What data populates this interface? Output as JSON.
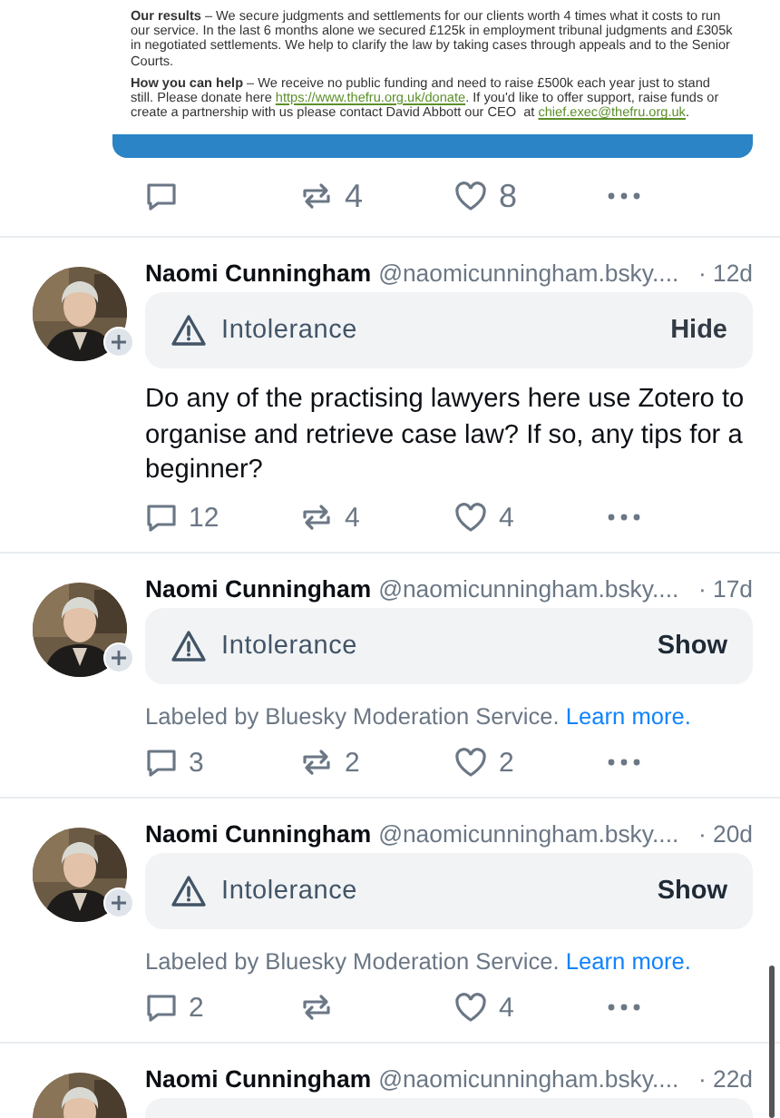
{
  "top_post": {
    "document": {
      "paragraphs": [
        [
          {
            "kind": "bold",
            "text": "Our results"
          },
          {
            "kind": "text",
            "text": " – We secure judgments and settlements for our clients worth 4 times what it costs to run our service. In the last 6 months alone we secured £125k in employment tribunal judgments and £305k in negotiated settlements. We help to clarify the law by taking cases through appeals and to the Senior Courts."
          }
        ],
        [
          {
            "kind": "bold",
            "text": "How you can help"
          },
          {
            "kind": "text",
            "text": " – We receive no public funding and need to raise £500k each year just to stand still. Please donate here "
          },
          {
            "kind": "link",
            "text": "https://www.thefru.org.uk/donate"
          },
          {
            "kind": "text",
            "text": ". If you'd like to offer support, raise funds or create a partnership with us please contact David Abbott our CEO  at "
          },
          {
            "kind": "link",
            "text": "chief.exec@thefru.org.uk"
          },
          {
            "kind": "text",
            "text": "."
          }
        ]
      ]
    },
    "actions": {
      "reposts": "4",
      "likes": "8"
    }
  },
  "posts": [
    {
      "author": "Naomi Cunningham",
      "handle": "@naomicunningham.bsky....",
      "time": "· 12d",
      "label": {
        "text": "Intolerance",
        "action": "Hide",
        "expanded": true
      },
      "body": "Do any of the practising lawyers here use Zotero to organise and retrieve case law? If so, any tips for a beginner?",
      "actions": {
        "replies": "12",
        "reposts": "4",
        "likes": "4"
      }
    },
    {
      "author": "Naomi Cunningham",
      "handle": "@naomicunningham.bsky....",
      "time": "· 17d",
      "label": {
        "text": "Intolerance",
        "action": "Show",
        "expanded": false
      },
      "note": {
        "text": "Labeled by Bluesky Moderation Service.",
        "link": "Learn more."
      },
      "actions": {
        "replies": "3",
        "reposts": "2",
        "likes": "2"
      }
    },
    {
      "author": "Naomi Cunningham",
      "handle": "@naomicunningham.bsky....",
      "time": "· 20d",
      "label": {
        "text": "Intolerance",
        "action": "Show",
        "expanded": false
      },
      "note": {
        "text": "Labeled by Bluesky Moderation Service.",
        "link": "Learn more."
      },
      "actions": {
        "replies": "2",
        "likes": "4"
      }
    },
    {
      "author": "Naomi Cunningham",
      "handle": "@naomicunningham.bsky....",
      "time": "· 22d"
    }
  ]
}
